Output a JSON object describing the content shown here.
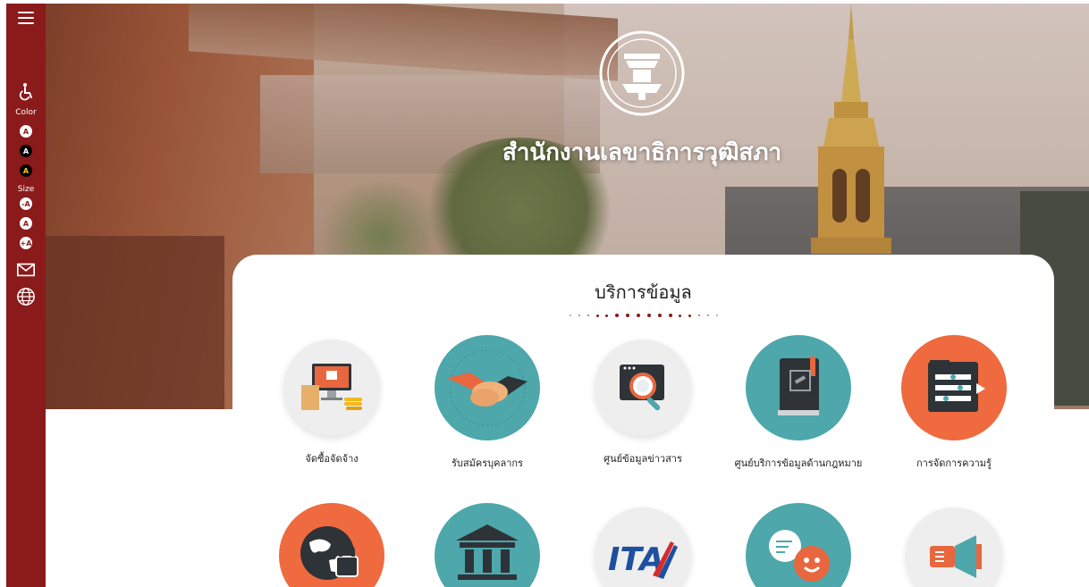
{
  "sidebar": {
    "color_label": "Color",
    "size_label": "Size",
    "color_buttons": [
      "A",
      "A",
      "A"
    ],
    "size_buttons": [
      "-A",
      "A",
      "+A"
    ],
    "accent": "#8b1a1a"
  },
  "hero": {
    "title": "สำนักงานเลขาธิการวุฒิสภา"
  },
  "services": {
    "title": "บริการข้อมูล",
    "items": [
      {
        "label": "จัดซื้อจัดจ้าง",
        "icon": "procurement-computer-icon"
      },
      {
        "label": "รับสมัครบุคลากร",
        "icon": "handshake-icon"
      },
      {
        "label": "ศูนย์ข้อมูลข่าวสาร",
        "icon": "folder-search-icon"
      },
      {
        "label": "ศูนย์บริการข้อมูลด้านกฎหมาย",
        "icon": "law-book-icon"
      },
      {
        "label": "การจัดการความรู้",
        "icon": "knowledge-folder-icon"
      }
    ],
    "row2_icons": [
      "globe-lock-icon",
      "government-building-icon",
      "ita-logo-icon",
      "chat-bubble-icon",
      "megaphone-icon"
    ]
  },
  "colors": {
    "teal": "#4da7ab",
    "orange": "#ef6a3e",
    "sidebar": "#8b1a1a"
  }
}
